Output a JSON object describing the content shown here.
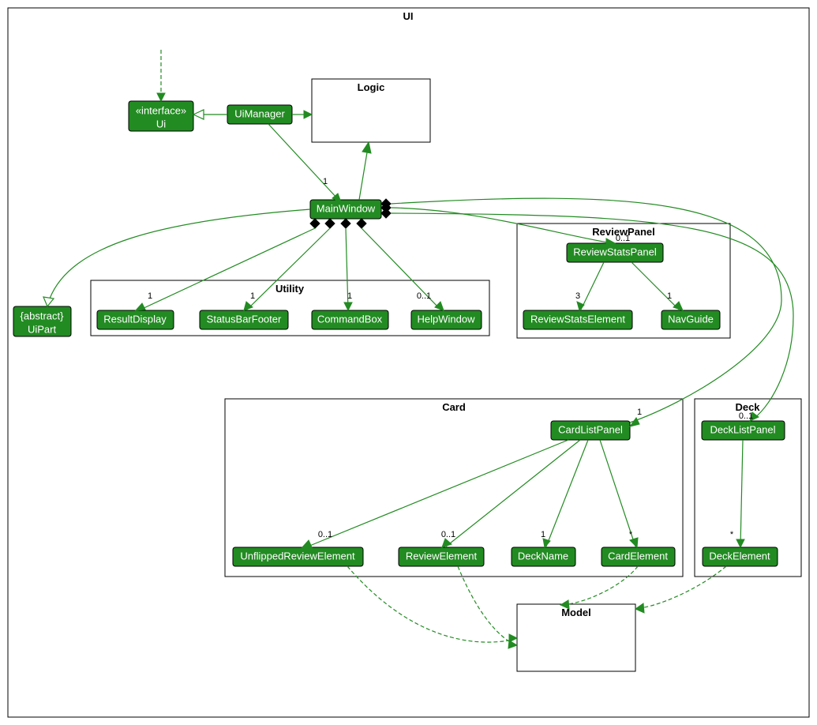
{
  "packages": {
    "ui": "UI",
    "logic": "Logic",
    "utility": "Utility",
    "reviewpanel": "ReviewPanel",
    "card": "Card",
    "deck": "Deck",
    "model": "Model"
  },
  "nodes": {
    "interface_line1": "«interface»",
    "interface_line2": "Ui",
    "uimanager": "UiManager",
    "mainwindow": "MainWindow",
    "uipart_line1": "{abstract}",
    "uipart_line2": "UiPart",
    "resultdisplay": "ResultDisplay",
    "statusbarfooter": "StatusBarFooter",
    "commandbox": "CommandBox",
    "helpwindow": "HelpWindow",
    "reviewstatspanel": "ReviewStatsPanel",
    "reviewstatselement": "ReviewStatsElement",
    "navguide": "NavGuide",
    "cardlistpanel": "CardListPanel",
    "unflippedreviewelement": "UnflippedReviewElement",
    "reviewelement": "ReviewElement",
    "deckname": "DeckName",
    "cardelement": "CardElement",
    "decklistpanel": "DeckListPanel",
    "deckelement": "DeckElement"
  },
  "multiplicities": {
    "uimanager_mainwindow": "1",
    "mainwindow_resultdisplay": "1",
    "mainwindow_statusbarfooter": "1",
    "mainwindow_commandbox": "1",
    "mainwindow_helpwindow": "0..1",
    "mainwindow_reviewstatspanel": "0..1",
    "reviewstatspanel_reviewstatselement": "3",
    "reviewstatspanel_navguide": "1",
    "mainwindow_cardlistpanel": "1",
    "cardlistpanel_unflippedreviewelement": "0..1",
    "cardlistpanel_reviewelement": "0..1",
    "cardlistpanel_deckname": "1",
    "cardlistpanel_cardelement": "*",
    "mainwindow_decklistpanel": "0..1",
    "decklistpanel_deckelement": "*"
  }
}
